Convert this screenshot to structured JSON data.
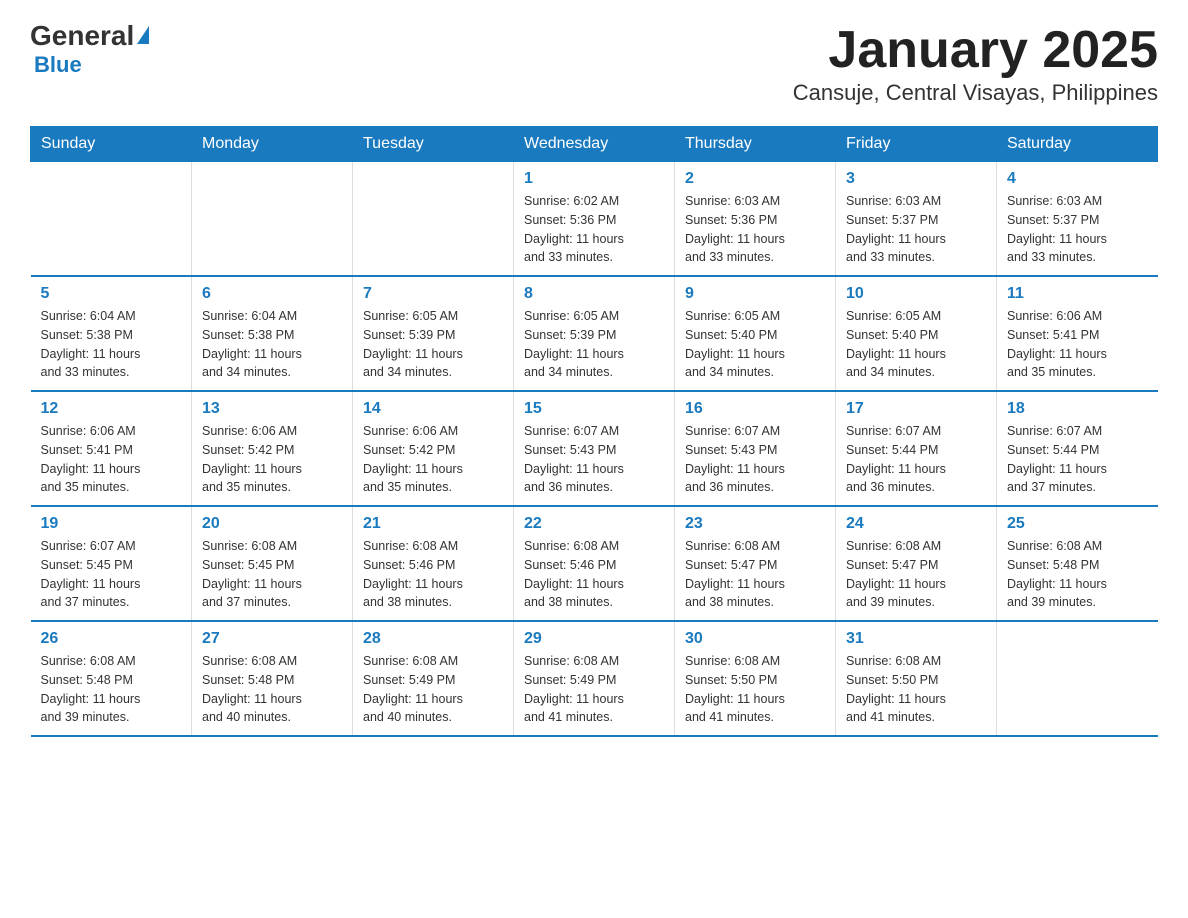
{
  "logo": {
    "general": "General",
    "blue": "Blue"
  },
  "title": "January 2025",
  "subtitle": "Cansuje, Central Visayas, Philippines",
  "weekdays": [
    "Sunday",
    "Monday",
    "Tuesday",
    "Wednesday",
    "Thursday",
    "Friday",
    "Saturday"
  ],
  "weeks": [
    [
      {
        "day": "",
        "info": ""
      },
      {
        "day": "",
        "info": ""
      },
      {
        "day": "",
        "info": ""
      },
      {
        "day": "1",
        "info": "Sunrise: 6:02 AM\nSunset: 5:36 PM\nDaylight: 11 hours\nand 33 minutes."
      },
      {
        "day": "2",
        "info": "Sunrise: 6:03 AM\nSunset: 5:36 PM\nDaylight: 11 hours\nand 33 minutes."
      },
      {
        "day": "3",
        "info": "Sunrise: 6:03 AM\nSunset: 5:37 PM\nDaylight: 11 hours\nand 33 minutes."
      },
      {
        "day": "4",
        "info": "Sunrise: 6:03 AM\nSunset: 5:37 PM\nDaylight: 11 hours\nand 33 minutes."
      }
    ],
    [
      {
        "day": "5",
        "info": "Sunrise: 6:04 AM\nSunset: 5:38 PM\nDaylight: 11 hours\nand 33 minutes."
      },
      {
        "day": "6",
        "info": "Sunrise: 6:04 AM\nSunset: 5:38 PM\nDaylight: 11 hours\nand 34 minutes."
      },
      {
        "day": "7",
        "info": "Sunrise: 6:05 AM\nSunset: 5:39 PM\nDaylight: 11 hours\nand 34 minutes."
      },
      {
        "day": "8",
        "info": "Sunrise: 6:05 AM\nSunset: 5:39 PM\nDaylight: 11 hours\nand 34 minutes."
      },
      {
        "day": "9",
        "info": "Sunrise: 6:05 AM\nSunset: 5:40 PM\nDaylight: 11 hours\nand 34 minutes."
      },
      {
        "day": "10",
        "info": "Sunrise: 6:05 AM\nSunset: 5:40 PM\nDaylight: 11 hours\nand 34 minutes."
      },
      {
        "day": "11",
        "info": "Sunrise: 6:06 AM\nSunset: 5:41 PM\nDaylight: 11 hours\nand 35 minutes."
      }
    ],
    [
      {
        "day": "12",
        "info": "Sunrise: 6:06 AM\nSunset: 5:41 PM\nDaylight: 11 hours\nand 35 minutes."
      },
      {
        "day": "13",
        "info": "Sunrise: 6:06 AM\nSunset: 5:42 PM\nDaylight: 11 hours\nand 35 minutes."
      },
      {
        "day": "14",
        "info": "Sunrise: 6:06 AM\nSunset: 5:42 PM\nDaylight: 11 hours\nand 35 minutes."
      },
      {
        "day": "15",
        "info": "Sunrise: 6:07 AM\nSunset: 5:43 PM\nDaylight: 11 hours\nand 36 minutes."
      },
      {
        "day": "16",
        "info": "Sunrise: 6:07 AM\nSunset: 5:43 PM\nDaylight: 11 hours\nand 36 minutes."
      },
      {
        "day": "17",
        "info": "Sunrise: 6:07 AM\nSunset: 5:44 PM\nDaylight: 11 hours\nand 36 minutes."
      },
      {
        "day": "18",
        "info": "Sunrise: 6:07 AM\nSunset: 5:44 PM\nDaylight: 11 hours\nand 37 minutes."
      }
    ],
    [
      {
        "day": "19",
        "info": "Sunrise: 6:07 AM\nSunset: 5:45 PM\nDaylight: 11 hours\nand 37 minutes."
      },
      {
        "day": "20",
        "info": "Sunrise: 6:08 AM\nSunset: 5:45 PM\nDaylight: 11 hours\nand 37 minutes."
      },
      {
        "day": "21",
        "info": "Sunrise: 6:08 AM\nSunset: 5:46 PM\nDaylight: 11 hours\nand 38 minutes."
      },
      {
        "day": "22",
        "info": "Sunrise: 6:08 AM\nSunset: 5:46 PM\nDaylight: 11 hours\nand 38 minutes."
      },
      {
        "day": "23",
        "info": "Sunrise: 6:08 AM\nSunset: 5:47 PM\nDaylight: 11 hours\nand 38 minutes."
      },
      {
        "day": "24",
        "info": "Sunrise: 6:08 AM\nSunset: 5:47 PM\nDaylight: 11 hours\nand 39 minutes."
      },
      {
        "day": "25",
        "info": "Sunrise: 6:08 AM\nSunset: 5:48 PM\nDaylight: 11 hours\nand 39 minutes."
      }
    ],
    [
      {
        "day": "26",
        "info": "Sunrise: 6:08 AM\nSunset: 5:48 PM\nDaylight: 11 hours\nand 39 minutes."
      },
      {
        "day": "27",
        "info": "Sunrise: 6:08 AM\nSunset: 5:48 PM\nDaylight: 11 hours\nand 40 minutes."
      },
      {
        "day": "28",
        "info": "Sunrise: 6:08 AM\nSunset: 5:49 PM\nDaylight: 11 hours\nand 40 minutes."
      },
      {
        "day": "29",
        "info": "Sunrise: 6:08 AM\nSunset: 5:49 PM\nDaylight: 11 hours\nand 41 minutes."
      },
      {
        "day": "30",
        "info": "Sunrise: 6:08 AM\nSunset: 5:50 PM\nDaylight: 11 hours\nand 41 minutes."
      },
      {
        "day": "31",
        "info": "Sunrise: 6:08 AM\nSunset: 5:50 PM\nDaylight: 11 hours\nand 41 minutes."
      },
      {
        "day": "",
        "info": ""
      }
    ]
  ]
}
